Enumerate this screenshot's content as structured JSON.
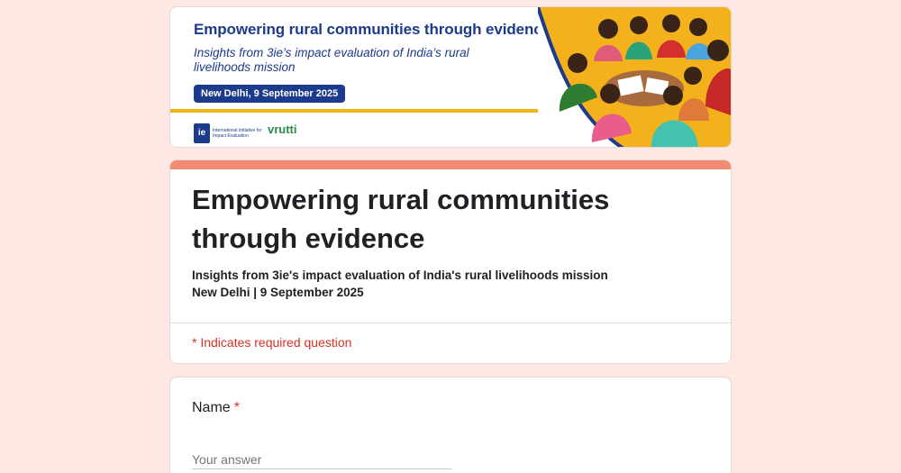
{
  "banner": {
    "title": "Empowering rural communities through evidence",
    "subtitle": "Insights from 3ie’s impact evaluation of India’s rural livelihoods mission",
    "date_badge": "New Delhi, 9 September 2025",
    "logo_3ie_mark": "ie",
    "logo_3ie_text": "International Initiative for Impact Evaluation",
    "logo_vrutti": "vrutti",
    "accent_color": "#1d3b8c",
    "stripe_color": "#f0b418"
  },
  "form": {
    "title": "Empowering rural communities through evidence",
    "description_line1": "Insights from 3ie's impact evaluation of India's rural livelihoods mission",
    "description_line2": "New Delhi | 9 September 2025",
    "required_note": "* Indicates required question",
    "accent_color": "#f28b72"
  },
  "questions": [
    {
      "label": "Name",
      "required_mark": "*",
      "placeholder": "Your answer"
    }
  ]
}
